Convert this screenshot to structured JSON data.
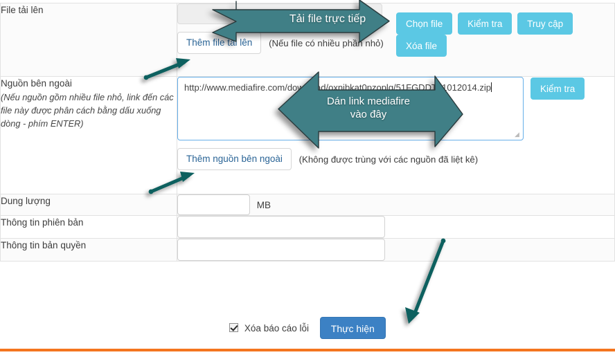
{
  "colors": {
    "cyan_button": "#5bc8e4",
    "blue_button": "#3c81c4",
    "arrow_teal": "#407f86",
    "arrow_line_teal": "#11605f",
    "orange_rule": "#f4751f",
    "textarea_focus_border": "#66afe9"
  },
  "form": {
    "rows": [
      {
        "label": "File tải lên",
        "file_input_value": "",
        "add_file_button": "Thêm file tải lên",
        "add_file_note": "(Nếu file có nhiều phần nhỏ)",
        "actions": [
          "Chọn file",
          "Kiểm tra",
          "Truy cập",
          "Xóa file"
        ]
      },
      {
        "label": "Nguồn bên ngoài",
        "label_hint": "(Nếu nguồn gồm nhiều file nhỏ, link đến các file này được phân cách bằng dấu xuống dòng - phím ENTER)",
        "textarea_value": "http://www.mediafire.com/download/oxnibkat0pzoplg/51FGDDT21012014.zip",
        "textarea_placeholder": "",
        "check_button": "Kiểm tra",
        "add_source_button": "Thêm nguồn bên ngoài",
        "add_source_note": "(Không được trùng với các nguồn đã liệt kê)"
      },
      {
        "label": "Dung lượng",
        "size_value": "",
        "size_placeholder": "",
        "unit": "MB"
      },
      {
        "label": "Thông tin phiên bản",
        "value": "",
        "placeholder": ""
      },
      {
        "label": "Thông tin bản quyền",
        "value": "",
        "placeholder": ""
      }
    ]
  },
  "footer": {
    "checkbox_label": "Xóa báo cáo lỗi",
    "checkbox_checked": true,
    "submit_button": "Thực hiện"
  },
  "annotations": [
    {
      "id": "upload-arrow",
      "text": "Tải file trực tiếp",
      "direction": "right"
    },
    {
      "id": "paste-arrow",
      "text": "Dán link mediafire\nvào đây",
      "direction": "left"
    },
    {
      "id": "add-file-pointer",
      "text": "",
      "direction": "up-right"
    },
    {
      "id": "add-source-pointer",
      "text": "",
      "direction": "up-right"
    },
    {
      "id": "submit-pointer",
      "text": "",
      "direction": "down-left"
    }
  ],
  "annotation_text": {
    "upload": "Tải file trực tiếp",
    "paste_line1": "Dán link mediafire",
    "paste_line2": "vào đây"
  }
}
